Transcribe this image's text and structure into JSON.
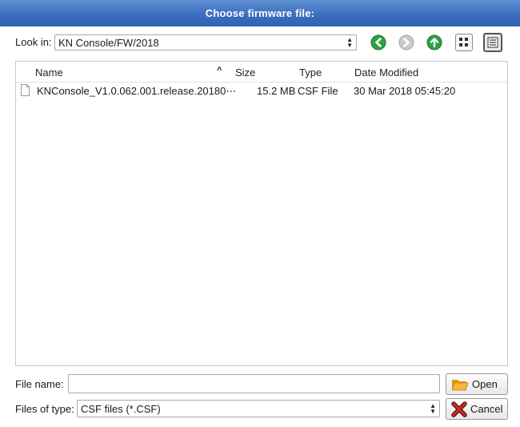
{
  "window": {
    "title": "Choose firmware file:"
  },
  "lookin": {
    "label": "Look in:",
    "value": "KN Console/FW/2018"
  },
  "nav": {
    "back_icon": "back-arrow-icon",
    "forward_icon": "forward-arrow-icon",
    "up_icon": "up-arrow-icon",
    "list_view_icon": "list-view-icon",
    "detail_view_icon": "detail-view-icon"
  },
  "columns": {
    "name": "Name",
    "size": "Size",
    "type": "Type",
    "date": "Date Modified"
  },
  "files": [
    {
      "name": "KNConsole_V1.0.062.001.release.20180⋯",
      "size": "15.2 MB",
      "type": "CSF File",
      "date": "30 Mar 2018 05:45:20"
    }
  ],
  "filename": {
    "label": "File name:",
    "value": ""
  },
  "filetype": {
    "label": "Files of type:",
    "value": "CSF files (*.CSF)"
  },
  "buttons": {
    "open": "Open",
    "cancel": "Cancel"
  },
  "colors": {
    "titlebar": "#3c6fc0",
    "nav_green": "#2ea043",
    "nav_disabled": "#b8b8b8",
    "cancel_red": "#c62828",
    "folder_orange": "#f0a020"
  }
}
